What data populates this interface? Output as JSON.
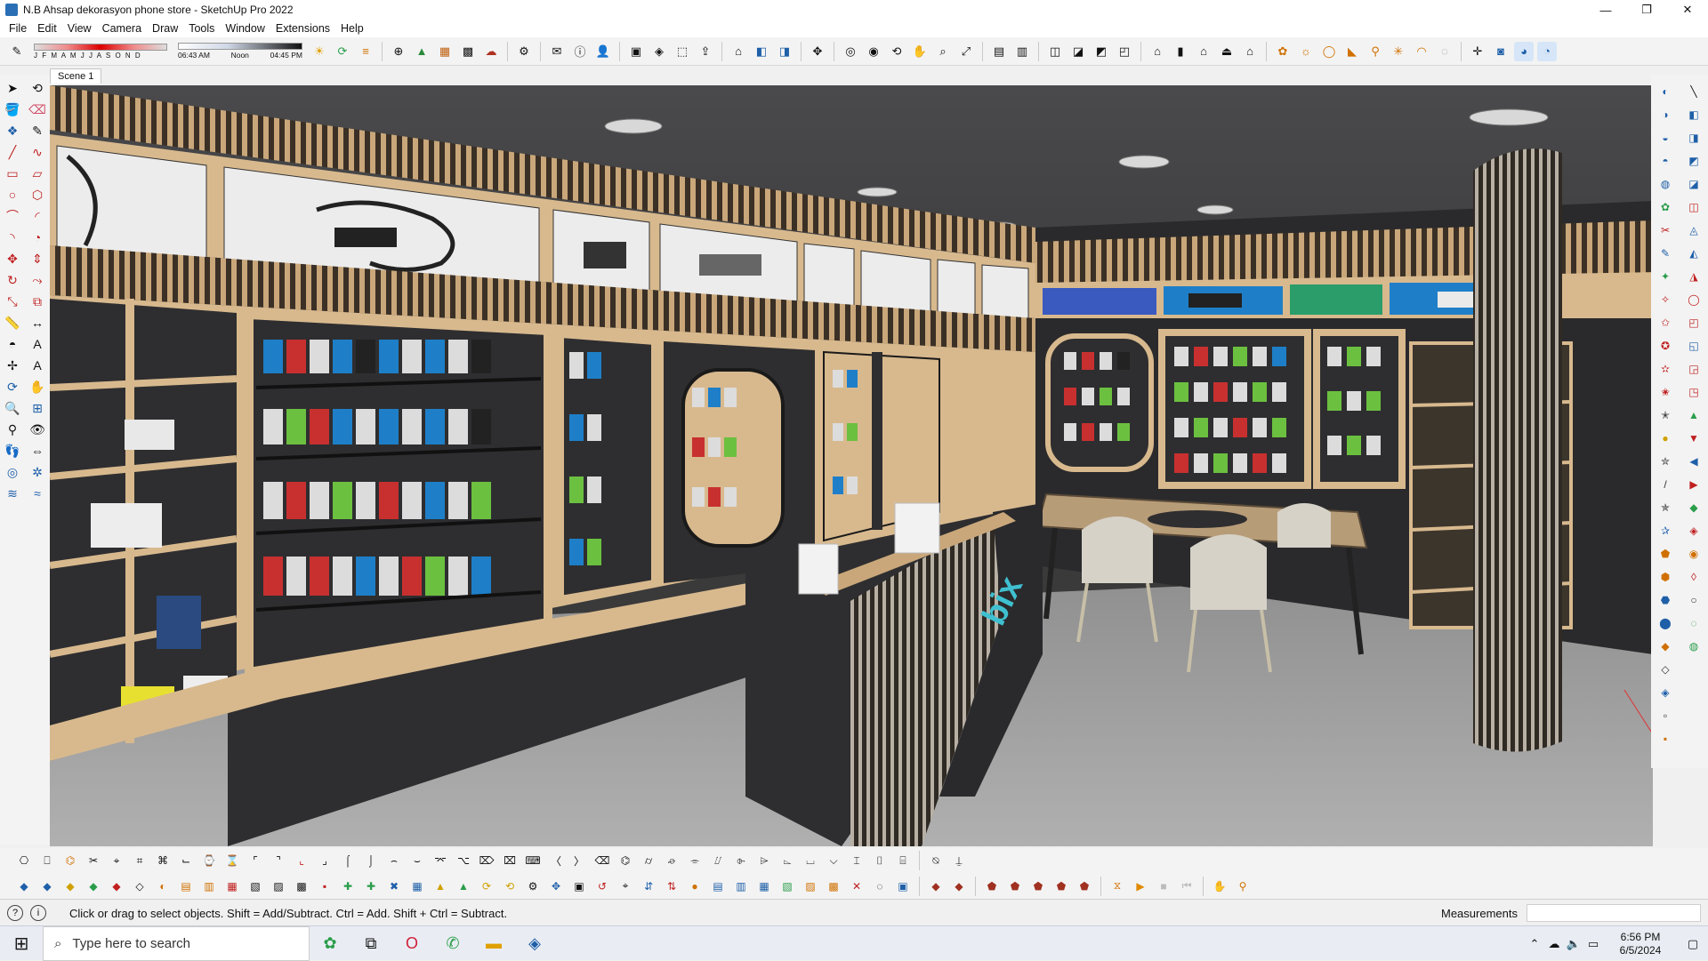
{
  "window": {
    "title": "N.B Ahsap dekorasyon phone store - SketchUp Pro 2022",
    "minimize_glyph": "—",
    "maximize_glyph": "❐",
    "close_glyph": "✕"
  },
  "menubar": {
    "items": [
      "File",
      "Edit",
      "View",
      "Camera",
      "Draw",
      "Tools",
      "Window",
      "Extensions",
      "Help"
    ]
  },
  "shadows": {
    "months_label": "J F M A M J J A S O N D",
    "time_start": "06:43 AM",
    "time_mid": "Noon",
    "time_end": "04:45 PM"
  },
  "scene_tabs": [
    "Scene 1"
  ],
  "viewport": {
    "brand_logo_text": "bix",
    "colors": {
      "wood": "#d8b98e",
      "dark_panel": "#2e2e30",
      "slat_light": "#c9a77a",
      "slat_dark": "#3b3026",
      "floor": "#9a9a9a",
      "ceiling": "#3e3e40",
      "accent_blue": "#1e7fc8",
      "accent_teal": "#3fc0d0"
    }
  },
  "statusbar": {
    "info_glyph": "i",
    "message": "Click or drag to select objects. Shift = Add/Subtract. Ctrl = Add. Shift + Ctrl = Subtract.",
    "measurements_label": "Measurements",
    "measurements_value": ""
  },
  "taskbar": {
    "search_placeholder": "Type here to search",
    "time": "6:56 PM",
    "date": "6/5/2024"
  }
}
